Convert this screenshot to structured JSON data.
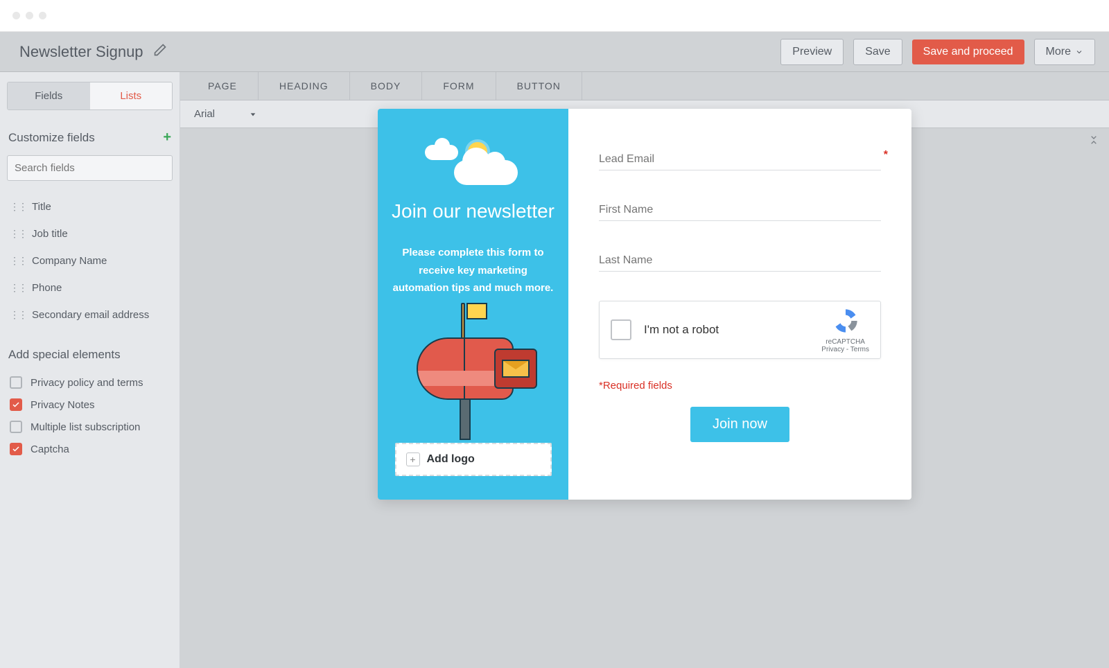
{
  "header": {
    "title": "Newsletter Signup",
    "preview": "Preview",
    "save": "Save",
    "save_proceed": "Save and proceed",
    "more": "More"
  },
  "sidebar": {
    "seg": {
      "fields": "Fields",
      "lists": "Lists"
    },
    "customize_title": "Customize fields",
    "search_placeholder": "Search fields",
    "fields": [
      {
        "label": "Title"
      },
      {
        "label": "Job title"
      },
      {
        "label": "Company Name"
      },
      {
        "label": "Phone"
      },
      {
        "label": "Secondary email address"
      }
    ],
    "special_title": "Add special elements",
    "specials": [
      {
        "label": "Privacy policy and terms",
        "checked": false
      },
      {
        "label": "Privacy Notes",
        "checked": true
      },
      {
        "label": "Multiple list subscription",
        "checked": false
      },
      {
        "label": "Captcha",
        "checked": true
      }
    ]
  },
  "tabs": [
    "PAGE",
    "HEADING",
    "BODY",
    "FORM",
    "BUTTON"
  ],
  "toolbar": {
    "font": "Arial"
  },
  "preview": {
    "banner_title": "Join our newsletter",
    "banner_text": "Please complete this form to receive key marketing automation tips and much more.",
    "add_logo": "Add logo",
    "fields": {
      "email": "Lead Email",
      "first": "First Name",
      "last": "Last Name"
    },
    "captcha": {
      "label": "I'm not a robot",
      "brand": "reCAPTCHA",
      "privacy": "Privacy - Terms"
    },
    "required_text": "*Required fields",
    "submit": "Join now"
  }
}
